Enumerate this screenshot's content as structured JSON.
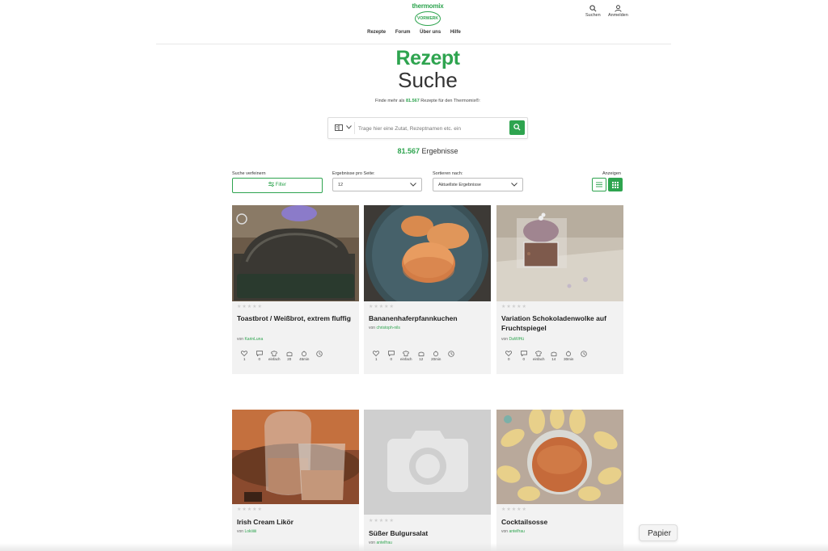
{
  "header": {
    "logo_text": "thermomix",
    "logo_sub": "VORWERK",
    "search_label": "Suchen",
    "login_label": "Anmelden"
  },
  "nav": {
    "items": [
      "Rezepte",
      "Forum",
      "Über uns",
      "Hilfe"
    ]
  },
  "hero": {
    "title_line1": "Rezept",
    "title_line2": "Suche",
    "sub_prefix": "Finde mehr als ",
    "sub_count": "81.567",
    "sub_suffix": " Rezepte für den Thermomix®:"
  },
  "search": {
    "placeholder": "Trage hier eine Zutat, Rezeptnamen etc. ein"
  },
  "results": {
    "count": "81.567",
    "label": " Ergebnisse"
  },
  "toolbar": {
    "refine_label": "Suche verfeinern",
    "filter_label": "Filter",
    "per_page_label": "Ergebnisse pro Seite:",
    "per_page_value": "12",
    "sort_label": "Sortieren nach:",
    "sort_value": "Aktuellste Ergebnisse",
    "view_label": "Anzeigen"
  },
  "recipes": [
    {
      "title": "Toastbrot / Weißbrot, extrem fluffig",
      "author_prefix": "von ",
      "author": "KarinLuna",
      "likes": "1",
      "comments": "0",
      "difficulty": "einfach",
      "portions": "20",
      "time": "45min"
    },
    {
      "title": "Bananenhaferpfannkuchen",
      "author_prefix": "von ",
      "author": "christoph-nils",
      "likes": "1",
      "comments": "0",
      "difficulty": "einfach",
      "portions": "12",
      "time": "20min"
    },
    {
      "title": "Variation Schokoladenwolke auf Fruchtspiegel",
      "author_prefix": "von ",
      "author": "DaWiHü",
      "likes": "0",
      "comments": "0",
      "difficulty": "einfach",
      "portions": "14",
      "time": "30min"
    },
    {
      "title": "Irish Cream Likör",
      "author_prefix": "von ",
      "author": "Lokiiiiii"
    },
    {
      "title": "Süßer Bulgursalat",
      "author_prefix": "von ",
      "author": "antelfrau"
    },
    {
      "title": "Cocktailsosse",
      "author_prefix": "von ",
      "author": "antelfrau"
    }
  ],
  "papier_label": "Papier"
}
